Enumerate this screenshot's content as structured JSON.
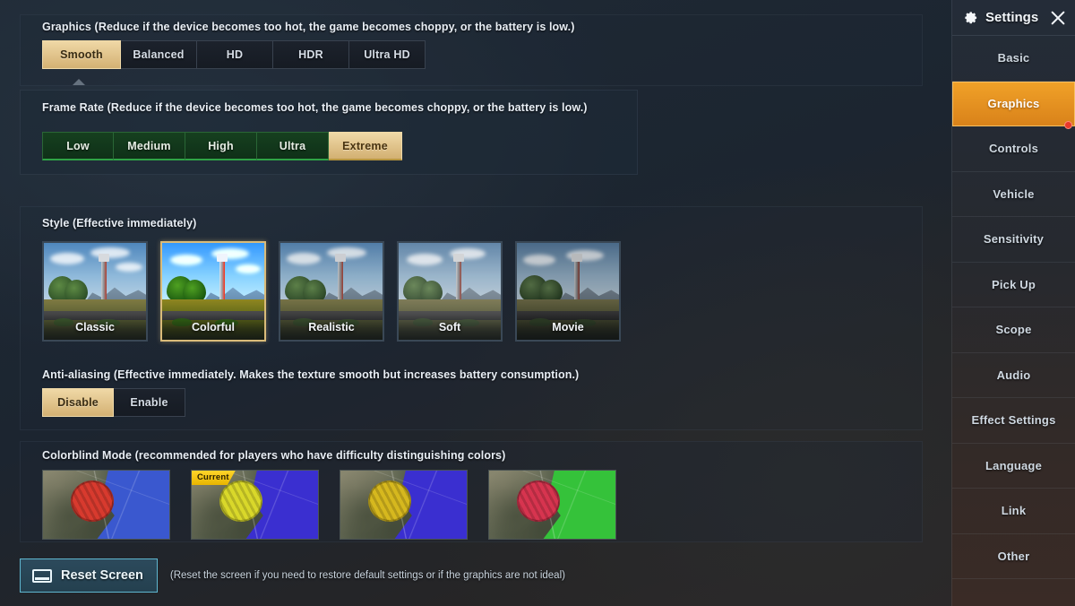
{
  "graphics": {
    "label": "Graphics (Reduce if the device becomes too hot, the game becomes choppy, or the battery is low.)",
    "options": [
      "Smooth",
      "Balanced",
      "HD",
      "HDR",
      "Ultra HD"
    ],
    "selected": "Smooth"
  },
  "frame_rate": {
    "label": "Frame Rate (Reduce if the device becomes too hot, the game becomes choppy, or the battery is low.)",
    "options": [
      "Low",
      "Medium",
      "High",
      "Ultra",
      "Extreme"
    ],
    "selected": "Extreme"
  },
  "style": {
    "label": "Style (Effective immediately)",
    "options": [
      "Classic",
      "Colorful",
      "Realistic",
      "Soft",
      "Movie"
    ],
    "selected": "Colorful"
  },
  "anti_aliasing": {
    "label": "Anti-aliasing (Effective immediately. Makes the texture smooth but increases battery consumption.)",
    "options": [
      "Disable",
      "Enable"
    ],
    "selected": "Disable"
  },
  "colorblind": {
    "label": "Colorblind Mode (recommended for players who have difficulty distinguishing colors)",
    "current_badge": "Current",
    "selected_index": 1,
    "options": [
      {
        "zone_color": "#d83a2e",
        "water_color": "#3a58cf"
      },
      {
        "zone_color": "#d9d82a",
        "water_color": "#3a2fd0"
      },
      {
        "zone_color": "#d6b81e",
        "water_color": "#3a2fd0"
      },
      {
        "zone_color": "#d7344f",
        "water_color": "#35c23a"
      }
    ]
  },
  "reset": {
    "button_label": "Reset Screen",
    "icon": "screen-icon",
    "description": "(Reset the screen if you need to restore default settings or if the graphics are not ideal)",
    "accent_color": "#5fb6cf"
  },
  "sidebar": {
    "title": "Settings",
    "gear_icon": "gear-icon",
    "close_icon": "close-icon",
    "active_item": "Graphics",
    "accent_color": "#e8921e",
    "items": [
      {
        "label": "Basic",
        "badge": false
      },
      {
        "label": "Graphics",
        "badge": true
      },
      {
        "label": "Controls",
        "badge": false
      },
      {
        "label": "Vehicle",
        "badge": false
      },
      {
        "label": "Sensitivity",
        "badge": false
      },
      {
        "label": "Pick Up",
        "badge": false
      },
      {
        "label": "Scope",
        "badge": false
      },
      {
        "label": "Audio",
        "badge": false
      },
      {
        "label": "Effect Settings",
        "badge": false
      },
      {
        "label": "Language",
        "badge": false
      },
      {
        "label": "Link",
        "badge": false
      },
      {
        "label": "Other",
        "badge": false
      }
    ]
  }
}
